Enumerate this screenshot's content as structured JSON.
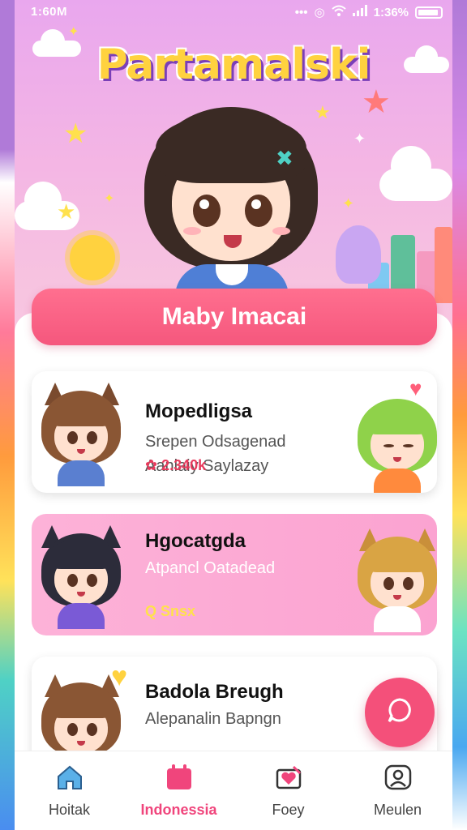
{
  "status_bar": {
    "time": "1:60M",
    "battery": "1:36%"
  },
  "hero": {
    "app_title": "Partamalski",
    "banner_label": "Maby Imacai"
  },
  "cards": [
    {
      "title": "Mopedligsa",
      "line1": "Srepen Odsagenad",
      "line2": "Aanlaiy Saylazay",
      "tag": "✿ 2.340k"
    },
    {
      "title": "Hgocatgda",
      "line1": "Atpancl Oatadead",
      "tag": "Q Snsx"
    },
    {
      "title": "Badola Breugh",
      "line1": "Alepanalin Bapngn"
    }
  ],
  "nav": {
    "items": [
      {
        "label": "Hoitak",
        "icon": "home-icon"
      },
      {
        "label": "Indonessia",
        "icon": "calendar-icon"
      },
      {
        "label": "Foey",
        "icon": "heart-gift-icon"
      },
      {
        "label": "Meulen",
        "icon": "profile-icon"
      }
    ],
    "active_index": 1
  },
  "colors": {
    "accent": "#f0457c",
    "banner": "#f5577d",
    "card_highlight": "#fba3d1",
    "logo_fill": "#ffd23f"
  }
}
